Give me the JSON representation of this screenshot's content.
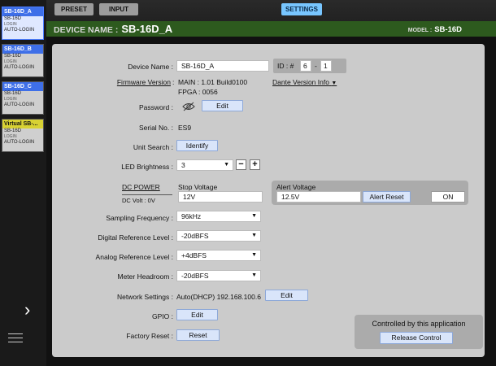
{
  "sidebar": {
    "devices": [
      {
        "name": "SB-16D_A",
        "model": "SB-16D",
        "login": "LOGIN",
        "auto_login": "AUTO-LOGIN"
      },
      {
        "name": "SB-16D_B",
        "model": "SB-16D",
        "login": "LOGIN",
        "auto_login": "AUTO-LOGIN"
      },
      {
        "name": "SB-16D_C",
        "model": "SB-16D",
        "login": "LOGIN",
        "auto_login": "AUTO-LOGIN"
      },
      {
        "name": "Virtual SB-...",
        "model": "SB-16D",
        "login": "LOGIN",
        "auto_login": "AUTO-LOGIN"
      }
    ],
    "expand_glyph": "›"
  },
  "topbar": {
    "preset_label": "PRESET",
    "input_label": "INPUT",
    "settings_label": "SETTINGS",
    "device_name_label": "DEVICE NAME :",
    "device_name": "SB-16D_A",
    "model_label": "MODEL :",
    "model": "SB-16D"
  },
  "settings": {
    "device_name_label": "Device Name :",
    "device_name_value": "SB-16D_A",
    "id_label": "ID : #",
    "id_value_1": "6",
    "id_sep": "-",
    "id_value_2": "1",
    "firmware_label": "Firmware Version",
    "firmware_colon": ":",
    "firmware_main": "MAIN :  1.01 Build0100",
    "firmware_fpga": "FPGA :  0056",
    "dante_version_label": "Dante Version Info",
    "dante_arrow": "▼",
    "password_label": "Password :",
    "password_edit": "Edit",
    "serial_label": "Serial No. :",
    "serial_value": "ES9",
    "unit_search_label": "Unit Search :",
    "identify_label": "Identify",
    "led_label": "LED Brightness :",
    "led_value": "3",
    "minus": "−",
    "plus": "+",
    "dc_power_label": "DC POWER",
    "dc_volt_label": "DC Volt : 0V",
    "stop_voltage_label": "Stop Voltage",
    "stop_voltage_value": "12V",
    "alert_voltage_label": "Alert Voltage",
    "alert_voltage_value": "12.5V",
    "alert_reset_label": "Alert Reset",
    "alert_on_label": "ON",
    "sampling_label": "Sampling Frequency :",
    "sampling_value": "96kHz",
    "digital_ref_label": "Digital Reference Level :",
    "digital_ref_value": "-20dBFS",
    "analog_ref_label": "Analog Reference Level :",
    "analog_ref_value": "+4dBFS",
    "meter_label": "Meter Headroom :",
    "meter_value": "-20dBFS",
    "network_label": "Network Settings :",
    "network_value": "Auto(DHCP) 192.168.100.6",
    "network_edit": "Edit",
    "gpio_label": "GPIO :",
    "gpio_edit": "Edit",
    "factory_label": "Factory Reset :",
    "factory_reset": "Reset",
    "controlled_label": "Controlled by this application",
    "release_label": "Release Control",
    "dropdown_arrow": "▼"
  }
}
